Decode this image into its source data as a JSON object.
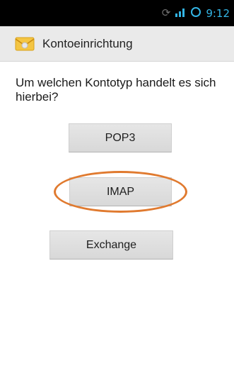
{
  "status_bar": {
    "clock": "9:12",
    "icons": [
      "sync-icon",
      "signal-icon",
      "circle-icon"
    ]
  },
  "action_bar": {
    "title": "Kontoeinrichtung",
    "icon": "email-envelope-icon"
  },
  "content": {
    "question": "Um welchen Kontotyp handelt es sich hierbei?",
    "buttons": {
      "pop3": "POP3",
      "imap": "IMAP",
      "exchange": "Exchange"
    }
  },
  "annotation": {
    "highlighted": "IMAP",
    "color": "#e07a2f"
  },
  "colors": {
    "status_accent": "#33b5e5",
    "action_bar_bg": "#eaeaea",
    "button_bg": "#dddddd"
  }
}
